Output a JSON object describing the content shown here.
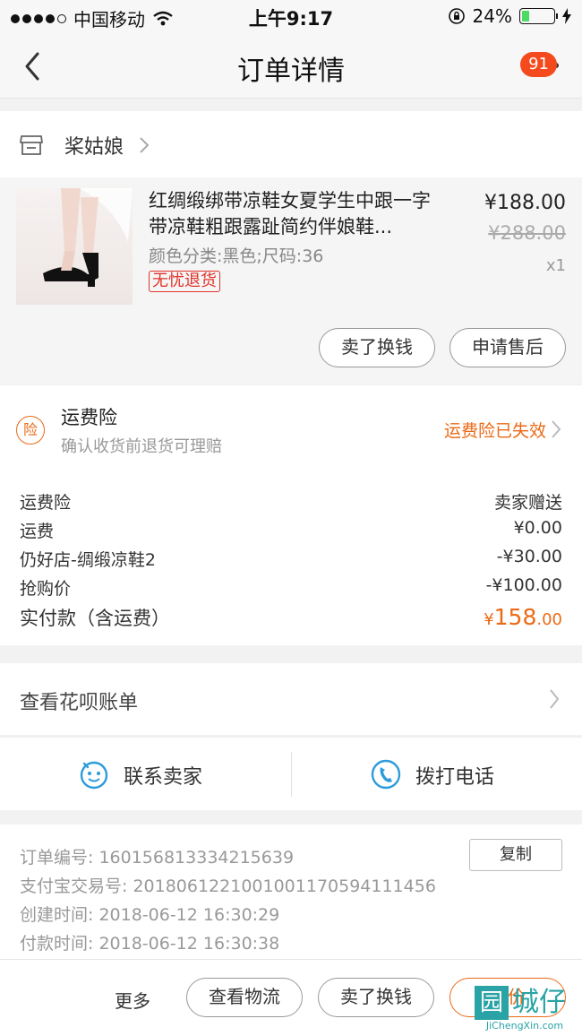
{
  "status_bar": {
    "carrier": "中国移动",
    "time": "上午9:17",
    "battery": "24%",
    "battery_level": 0.24
  },
  "nav": {
    "title": "订单详情",
    "badge": "91"
  },
  "shop": {
    "name": "桨姑娘"
  },
  "goods": {
    "title": "红绸缎绑带凉鞋女夏学生中跟一字带凉鞋粗跟露趾简约伴娘鞋...",
    "spec": "颜色分类:黑色;尺码:36",
    "tag": "无忧退货",
    "price": "¥188.00",
    "original_price": "¥288.00",
    "quantity": "x1",
    "btn_sell": "卖了换钱",
    "btn_after_sale": "申请售后"
  },
  "insurance": {
    "icon_char": "险",
    "title": "运费险",
    "subtitle": "确认收货前退货可理赔",
    "status": "运费险已失效"
  },
  "fees": [
    {
      "label": "运费险",
      "value": "卖家赠送"
    },
    {
      "label": "运费",
      "value": "¥0.00"
    },
    {
      "label": "仍好店-绸缎凉鞋2",
      "value": "-¥30.00"
    },
    {
      "label": "抢购价",
      "value": "-¥100.00"
    }
  ],
  "total": {
    "label": "实付款（含运费）",
    "currency": "¥",
    "amount_int": "158",
    "amount_dec": ".00"
  },
  "huabei": {
    "label": "查看花呗账单"
  },
  "contact": {
    "seller": "联系卖家",
    "phone": "拨打电话"
  },
  "order_info": {
    "order_no": "订单编号:  1601568133342156​39",
    "alipay_no": "支付宝交易号:  2018061221001001170594111456",
    "created": "创建时间:  2018-06-12 16:30:29",
    "paid": "付款时间:  2018-06-12 16:30:38",
    "copy": "复制"
  },
  "bottom": {
    "more": "更多",
    "logistics": "查看物流",
    "sell": "卖了换钱",
    "review": "评价"
  },
  "watermark": {
    "box": "园",
    "text": "城仔",
    "url": "JiChengXin.com"
  },
  "colors": {
    "accent": "#ea6a16",
    "badge": "#f54a1d",
    "tag": "#e0332b",
    "battery": "#4cd964",
    "watermark": "#29a3a6"
  }
}
